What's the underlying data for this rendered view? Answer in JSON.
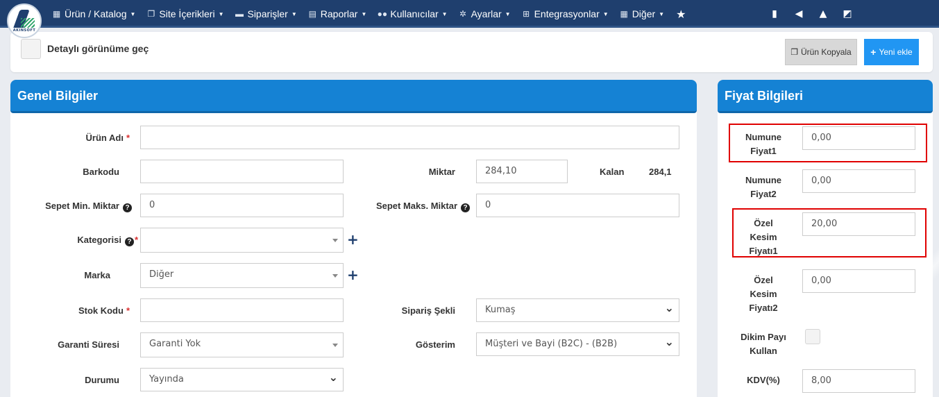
{
  "brand": {
    "logo_text": "AKINSOFT"
  },
  "nav": {
    "items": [
      {
        "label": "Ürün / Katalog",
        "icon": "cubes-icon"
      },
      {
        "label": "Site İçerikleri",
        "icon": "files-icon"
      },
      {
        "label": "Siparişler",
        "icon": "truck-icon"
      },
      {
        "label": "Raporlar",
        "icon": "report-icon"
      },
      {
        "label": "Kullanıcılar",
        "icon": "users-icon"
      },
      {
        "label": "Ayarlar",
        "icon": "cogs-icon"
      },
      {
        "label": "Entegrasyonlar",
        "icon": "sitemap-icon"
      },
      {
        "label": "Diğer",
        "icon": "grid-icon"
      }
    ]
  },
  "toolbar": {
    "detail_label": "Detaylı görünüme geç",
    "copy_label": "Ürün Kopyala",
    "new_label": "Yeni ekle"
  },
  "general": {
    "title": "Genel Bilgiler",
    "product_name_label": "Ürün Adı",
    "product_name_value": "",
    "barcode_label": "Barkodu",
    "barcode_value": "",
    "quantity_label": "Miktar",
    "quantity_value": "284,10",
    "remaining_label": "Kalan",
    "remaining_value": "284,1",
    "cart_min_label": "Sepet Min. Miktar",
    "cart_min_value": "0",
    "cart_max_label": "Sepet Maks. Miktar",
    "cart_max_value": "0",
    "category_label": "Kategorisi",
    "category_value": "",
    "brand_label": "Marka",
    "brand_value": "Diğer",
    "stock_code_label": "Stok Kodu",
    "stock_code_value": "",
    "order_type_label": "Sipariş Şekli",
    "order_type_value": "Kumaş",
    "warranty_label": "Garanti Süresi",
    "warranty_value": "Garanti Yok",
    "display_label": "Gösterim",
    "display_value": "Müşteri ve Bayi (B2C) - (B2B)",
    "status_label": "Durumu",
    "status_value": "Yayında"
  },
  "price": {
    "title": "Fiyat Bilgileri",
    "sample_price1_label_l1": "Numune",
    "sample_price1_label_l2": "Fiyat1",
    "sample_price1_value": "0,00",
    "sample_price2_label_l1": "Numune",
    "sample_price2_label_l2": "Fiyat2",
    "sample_price2_value": "0,00",
    "cut_price1_label_l1": "Özel",
    "cut_price1_label_l2": "Kesim",
    "cut_price1_label_l3": "Fiyatı1",
    "cut_price1_value": "20,00",
    "cut_price2_label_l1": "Özel",
    "cut_price2_label_l2": "Kesim",
    "cut_price2_label_l3": "Fiyatı2",
    "cut_price2_value": "0,00",
    "seam_label_l1": "Dikim Payı",
    "seam_label_l2": "Kullan",
    "vat_label": "KDV(%)",
    "vat_value": "8,00"
  },
  "colors": {
    "nav_bg": "#1f3f6e",
    "panel_head": "#1582d4",
    "primary_button": "#2196f3",
    "highlight": "#e00000"
  }
}
